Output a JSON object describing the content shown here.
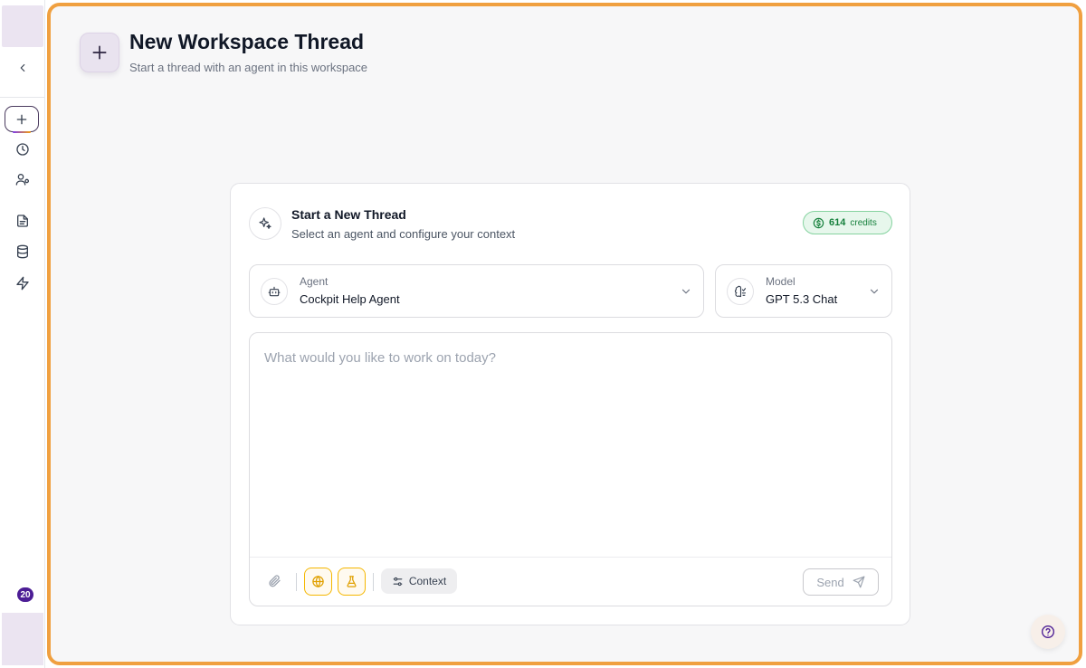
{
  "header": {
    "title": "New Workspace Thread",
    "subtitle": "Start a thread with an agent in this workspace"
  },
  "card": {
    "title": "Start a New Thread",
    "subtitle": "Select an agent and configure your context",
    "credits": {
      "amount": "614",
      "label": "credits"
    }
  },
  "agent_select": {
    "label": "Agent",
    "value": "Cockpit Help Agent"
  },
  "model_select": {
    "label": "Model",
    "value": "GPT 5.3 Chat"
  },
  "composer": {
    "placeholder": "What would you like to work on today?",
    "context_label": "Context",
    "send_label": "Send"
  },
  "rail": {
    "notification_count": "20",
    "icons": [
      "chevron-left-icon",
      "plus-icon",
      "clock-icon",
      "users-icon",
      "document-icon",
      "database-icon",
      "bolt-icon"
    ]
  },
  "colors": {
    "accent_frame": "#f0a040",
    "brand_purple": "#4c1d95",
    "credits_green": "#16803c",
    "tool_yellow": "#f5b700"
  }
}
